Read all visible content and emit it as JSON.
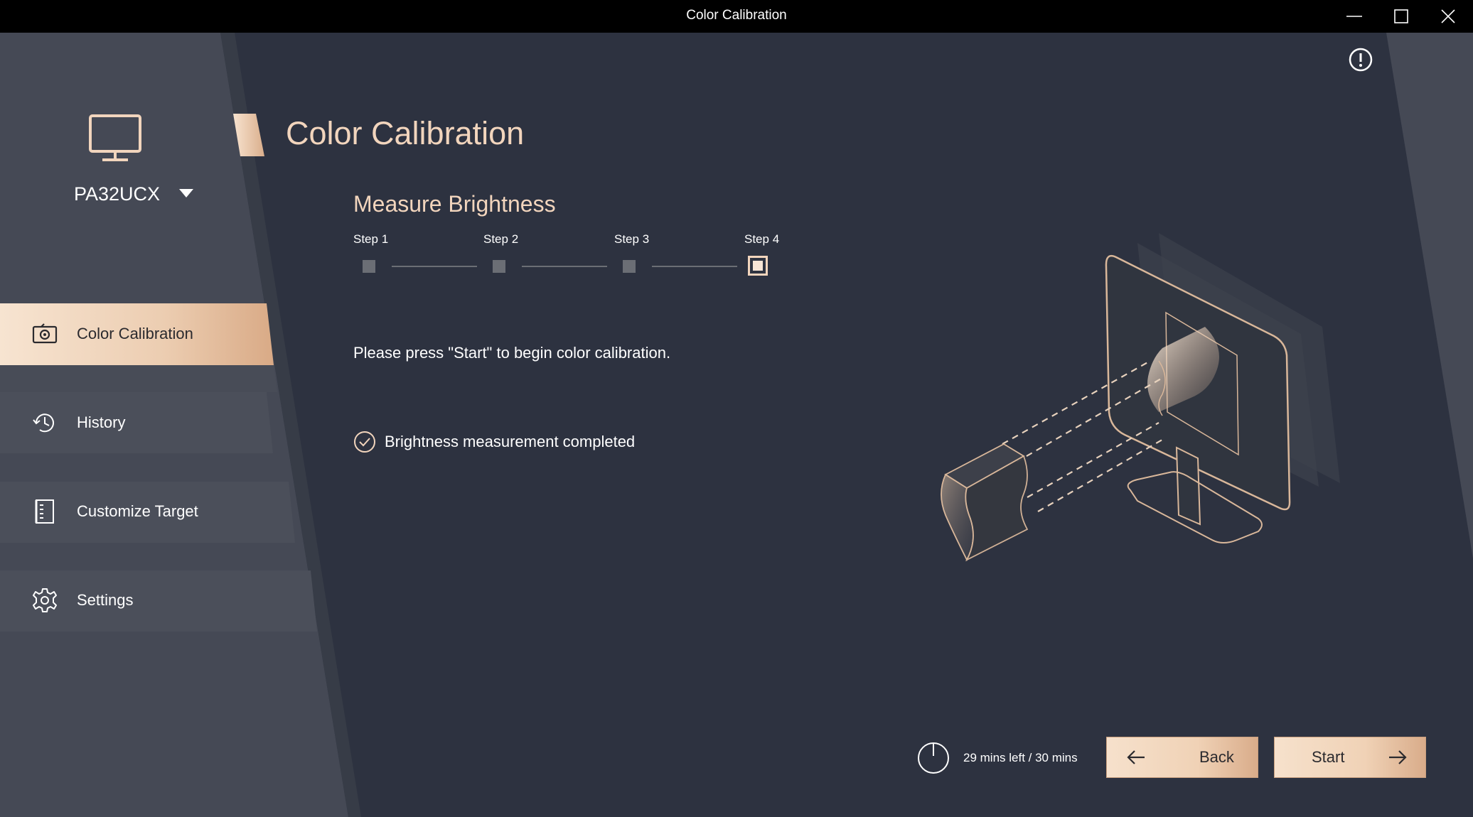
{
  "window": {
    "title": "Color Calibration"
  },
  "sidebar": {
    "device_name": "PA32UCX",
    "items": [
      {
        "label": "Color Calibration",
        "icon": "calibration-icon",
        "active": true
      },
      {
        "label": "History",
        "icon": "history-icon",
        "active": false
      },
      {
        "label": "Customize Target",
        "icon": "document-icon",
        "active": false
      },
      {
        "label": "Settings",
        "icon": "gear-icon",
        "active": false
      }
    ]
  },
  "main": {
    "title": "Color Calibration",
    "section_title": "Measure Brightness",
    "steps": [
      "Step 1",
      "Step 2",
      "Step 3",
      "Step 4"
    ],
    "current_step": 4,
    "instruction": "Please press \"Start\" to begin color calibration.",
    "status": "Brightness measurement completed"
  },
  "footer": {
    "timer": "29 mins left / 30 mins",
    "back_label": "Back",
    "start_label": "Start"
  },
  "colors": {
    "accent": "#f2d5bd",
    "background": "#2f3441",
    "sidebar": "#454955",
    "titlebar": "#000000"
  }
}
